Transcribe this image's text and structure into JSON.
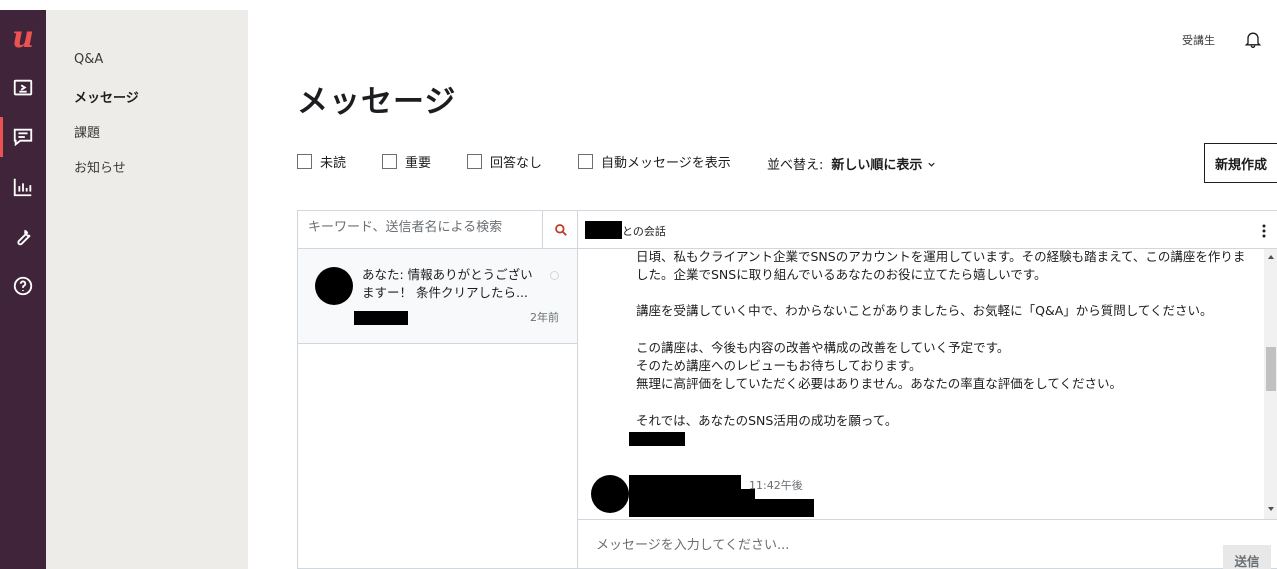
{
  "brand": {
    "logo_text": "u"
  },
  "rail": {
    "items": [
      {
        "icon": "play-screen-icon"
      },
      {
        "icon": "chat-icon",
        "active": true
      },
      {
        "icon": "bar-chart-icon"
      },
      {
        "icon": "wrench-icon"
      },
      {
        "icon": "help-icon"
      }
    ]
  },
  "subnav": {
    "items": [
      {
        "label": "Q&A"
      },
      {
        "label": "メッセージ",
        "active": true
      },
      {
        "label": "課題"
      },
      {
        "label": "お知らせ"
      }
    ]
  },
  "header": {
    "role_label": "受講生",
    "bell_icon": "bell-icon"
  },
  "page": {
    "title": "メッセージ"
  },
  "filters": {
    "unread": "未読",
    "important": "重要",
    "no_reply": "回答なし",
    "show_auto": "自動メッセージを表示",
    "sort_label": "並べ替え:",
    "sort_value": "新しい順に表示",
    "new_button": "新規作成"
  },
  "search": {
    "placeholder": "キーワード、送信者名による検索"
  },
  "conversations": [
    {
      "preview": "あなた: 情報ありがとうございますー！ 条件クリアしたら...",
      "time": "2年前"
    }
  ],
  "chat": {
    "title_suffix": "との会話",
    "paragraphs": [
      "日頃、私もクライアント企業でSNSのアカウントを運用しています。その経験も踏まえて、この講座を作りました。企業でSNSに取り組んでいるあなたのお役に立てたら嬉しいです。",
      "講座を受講していく中で、わからないことがありましたら、お気軽に「Q&A」から質問してください。",
      "この講座は、今後も内容の改善や構成の改善をしていく予定です。",
      "そのため講座へのレビューもお待ちしております。",
      "無理に高評価をしていただく必要はありません。あなたの率直な評価をしてください。",
      "それでは、あなたのSNS活用の成功を願って。"
    ],
    "last_time": "11:42午後",
    "composer_placeholder": "メッセージを入力してください...",
    "send_label": "送信"
  }
}
